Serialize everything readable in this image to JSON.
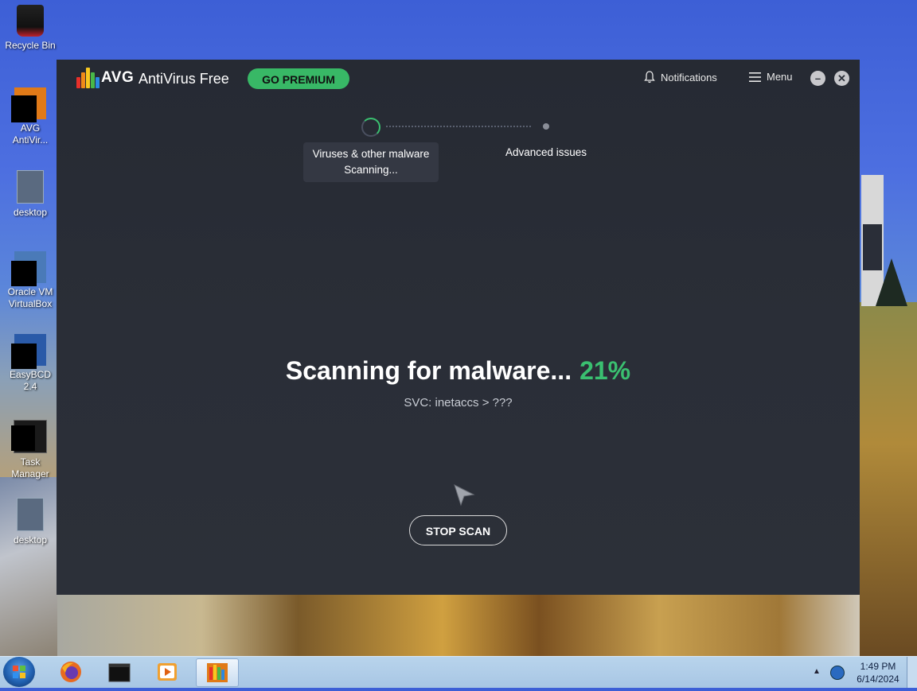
{
  "desktop": {
    "icons": [
      {
        "label": "Recycle Bin",
        "icon": "recycle-bin-icon"
      },
      {
        "label": "AVG\nAntiVir...",
        "icon": "avg-icon"
      },
      {
        "label": "desktop",
        "icon": "document-icon"
      },
      {
        "label": "Oracle VM\nVirtualBox",
        "icon": "virtualbox-icon"
      },
      {
        "label": "EasyBCD 2.4",
        "icon": "easybcd-icon"
      },
      {
        "label": "Task\nManager",
        "icon": "task-manager-icon"
      },
      {
        "label": "desktop",
        "icon": "document-icon"
      }
    ]
  },
  "app": {
    "brand": "AVG",
    "name": "AntiVirus Free",
    "premium_label": "GO PREMIUM",
    "notifications_label": "Notifications",
    "menu_label": "Menu",
    "minimize_symbol": "–",
    "close_symbol": "✕",
    "accent_color": "#3ac070",
    "steps": [
      {
        "title": "Viruses & other malware",
        "status": "Scanning..."
      },
      {
        "title": "Advanced issues",
        "status": ""
      }
    ],
    "scan_title": "Scanning for malware...",
    "scan_percent": "21%",
    "scan_progress": 0.21,
    "scan_item": "SVC: inetaccs > ???",
    "stop_label": "STOP SCAN"
  },
  "taskbar": {
    "items": [
      {
        "icon": "firefox-icon"
      },
      {
        "icon": "terminal-icon"
      },
      {
        "icon": "media-player-icon"
      },
      {
        "icon": "avg-icon",
        "active": true
      }
    ],
    "tray_arrow": "▲",
    "time": "1:49 PM",
    "date": "6/14/2024"
  }
}
